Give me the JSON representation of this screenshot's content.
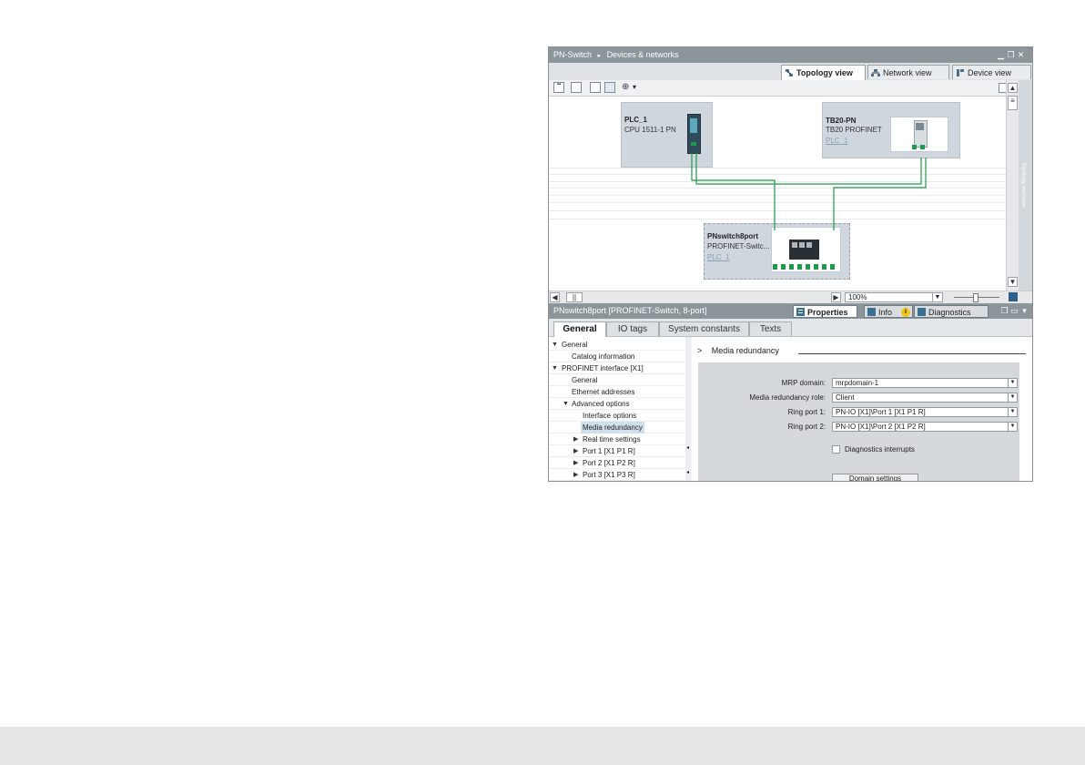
{
  "editor": {
    "breadcrumb_project": "PN-Switch",
    "breadcrumb_sep": "▸",
    "breadcrumb_page": "Devices & networks"
  },
  "view_tabs": [
    {
      "label": "Topology view",
      "active": true
    },
    {
      "label": "Network view",
      "active": false
    },
    {
      "label": "Device view",
      "active": false
    }
  ],
  "devices": {
    "plc": {
      "name": "PLC_1",
      "type": "CPU 1511-1 PN"
    },
    "tb20": {
      "name": "TB20-PN",
      "type": "TB20 PROFINET",
      "link": "PLC_1"
    },
    "switch": {
      "name": "PNswitch8port",
      "type": "PROFINET-Switc...",
      "link": "PLC_1"
    }
  },
  "side_panel_label": "Topology overview",
  "zoom": {
    "value": "100%"
  },
  "inspector": {
    "title": "PNswitch8port [PROFINET-Switch, 8-port]",
    "tabs": [
      {
        "label": "Properties",
        "active": true
      },
      {
        "label": "Info",
        "active": false
      },
      {
        "label": "Diagnostics",
        "active": false
      }
    ],
    "info_badge": "i"
  },
  "property_tabs": [
    {
      "label": "General",
      "active": true
    },
    {
      "label": "IO tags",
      "active": false
    },
    {
      "label": "System constants",
      "active": false
    },
    {
      "label": "Texts",
      "active": false
    }
  ],
  "tree": [
    {
      "label": "General",
      "arrow": "▼",
      "selected": false
    },
    {
      "label": "Catalog information",
      "arrow": "",
      "selected": false
    },
    {
      "label": "PROFINET interface [X1]",
      "arrow": "▼",
      "selected": false
    },
    {
      "label": "General",
      "arrow": "",
      "selected": false
    },
    {
      "label": "Ethernet addresses",
      "arrow": "",
      "selected": false
    },
    {
      "label": "Advanced options",
      "arrow": "▼",
      "selected": false
    },
    {
      "label": "Interface options",
      "arrow": "",
      "selected": false
    },
    {
      "label": "Media redundancy",
      "arrow": "",
      "selected": true
    },
    {
      "label": "Real time settings",
      "arrow": "▶",
      "selected": false
    },
    {
      "label": "Port 1 [X1 P1 R]",
      "arrow": "▶",
      "selected": false
    },
    {
      "label": "Port 2 [X1 P2 R]",
      "arrow": "▶",
      "selected": false
    },
    {
      "label": "Port 3 [X1 P3 R]",
      "arrow": "▶",
      "selected": false
    }
  ],
  "section": {
    "marker": ">",
    "title": "Media redundancy"
  },
  "form": {
    "mrp_domain": {
      "label": "MRP domain:",
      "value": "mrpdomain-1"
    },
    "role": {
      "label": "Media redundancy role:",
      "value": "Client"
    },
    "ring1": {
      "label": "Ring port 1:",
      "value": "PN-IO [X1]\\Port 1 [X1 P1 R]"
    },
    "ring2": {
      "label": "Ring port 2:",
      "value": "PN-IO [X1]\\Port 2 [X1 P2 R]"
    },
    "diag": {
      "label": "Diagnostics interrupts",
      "checked": false
    },
    "domain_button": "Domain settings"
  },
  "colors": {
    "titlebar": "#8b959a",
    "device_fill": "#cfd6de",
    "link_green": "#1f9a4a",
    "selection": "#cfe0ea"
  }
}
